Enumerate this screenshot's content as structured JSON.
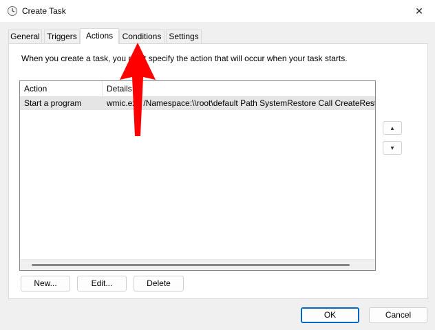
{
  "window": {
    "title": "Create Task",
    "close_glyph": "✕"
  },
  "tabs": [
    {
      "label": "General"
    },
    {
      "label": "Triggers"
    },
    {
      "label": "Actions"
    },
    {
      "label": "Conditions"
    },
    {
      "label": "Settings"
    }
  ],
  "actions_panel": {
    "description": "When you create a task, you must specify the action that will occur when your task starts.",
    "columns": {
      "action": "Action",
      "details": "Details"
    },
    "rows": [
      {
        "action": "Start a program",
        "details": "wmic.exe /Namespace:\\\\root\\default Path SystemRestore Call CreateRestorePoint"
      }
    ],
    "move_up_glyph": "▲",
    "move_down_glyph": "▼",
    "buttons": {
      "new": "New...",
      "edit": "Edit...",
      "delete": "Delete"
    }
  },
  "footer": {
    "ok": "OK",
    "cancel": "Cancel"
  },
  "annotation": {
    "arrow_color": "#ff0000"
  }
}
